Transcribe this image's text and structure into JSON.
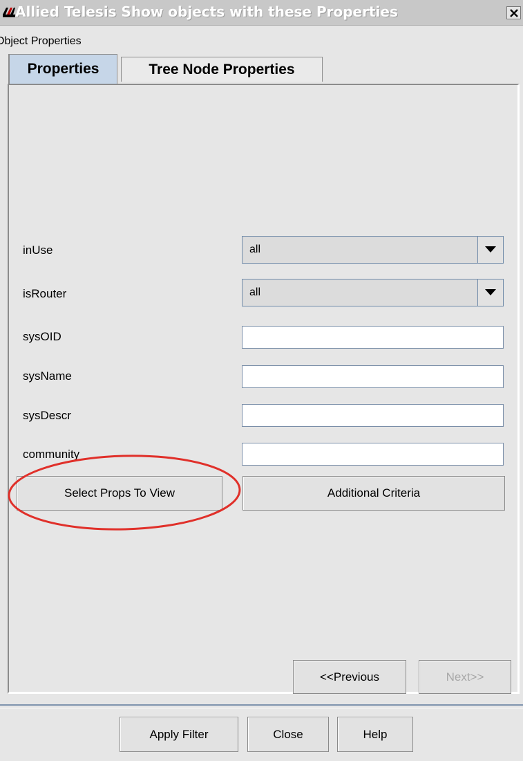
{
  "window": {
    "title": "Allied Telesis Show objects with these Properties",
    "close_glyph": "×"
  },
  "subtitle": "Object Properties",
  "tabs": [
    {
      "label": "Properties",
      "active": true
    },
    {
      "label": "Tree Node Properties",
      "active": false
    }
  ],
  "fields": {
    "inUse": {
      "label": "inUse",
      "value": "all"
    },
    "isRouter": {
      "label": "isRouter",
      "value": "all"
    },
    "sysOID": {
      "label": "sysOID",
      "value": ""
    },
    "sysName": {
      "label": "sysName",
      "value": ""
    },
    "sysDescr": {
      "label": "sysDescr",
      "value": ""
    },
    "community": {
      "label": "community",
      "value": ""
    }
  },
  "buttons": {
    "select_props": "Select Props To View",
    "additional_criteria": "Additional Criteria",
    "previous": "<<Previous",
    "next": "Next>>",
    "apply_filter": "Apply Filter",
    "close": "Close",
    "help": "Help"
  },
  "icons": {
    "app": "allied-telesis-logo-icon",
    "close": "close-icon",
    "dropdown": "chevron-down-icon"
  },
  "colors": {
    "active_tab": "#c6d6e8",
    "annotation": "#e0302a"
  }
}
